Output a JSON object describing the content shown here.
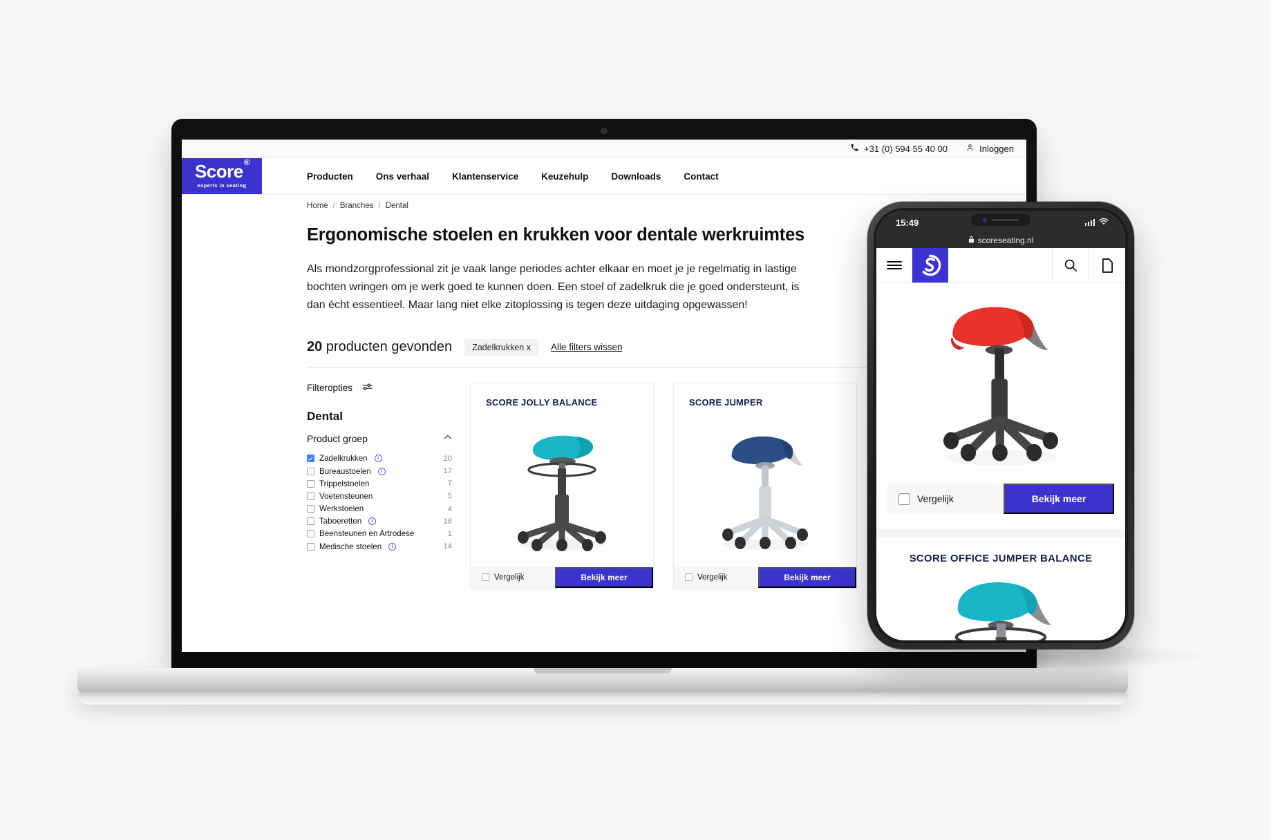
{
  "desktop": {
    "topbar": {
      "phone_icon": "phone-icon",
      "phone": "+31 (0) 594 55 40 00",
      "account_icon": "user-icon",
      "login": "Inloggen"
    },
    "logo": {
      "word": "Score",
      "sup": "®",
      "tagline": "experts in seating"
    },
    "nav": [
      {
        "label": "Producten"
      },
      {
        "label": "Ons verhaal"
      },
      {
        "label": "Klantenservice"
      },
      {
        "label": "Keuzehulp"
      },
      {
        "label": "Downloads"
      },
      {
        "label": "Contact"
      }
    ],
    "breadcrumbs": [
      "Home",
      "Branches",
      "Dental"
    ],
    "page_title": "Ergonomische stoelen en krukken voor dentale werkruimtes",
    "intro": "Als mondzorgprofessional zit je vaak lange periodes achter elkaar en moet je je regelmatig in lastige bochten wringen om je werk goed te kunnen doen. Een stoel of zadelkruk die je goed ondersteunt, is dan écht essentieel. Maar lang niet elke zitoplossing is tegen deze uitdaging opgewassen!",
    "results": {
      "count": "20",
      "count_suffix": " producten gevonden",
      "active_filter": "Zadelkrukken x",
      "clear_all": "Alle filters wissen"
    },
    "filters": {
      "heading": "Filteropties",
      "icon": "sliders-icon",
      "branch_title": "Dental",
      "group_label": "Product groep",
      "collapse_icon": "chevron-up-icon",
      "options": [
        {
          "label": "Zadelkrukken",
          "count": "20",
          "checked": true,
          "info": true
        },
        {
          "label": "Bureaustoelen",
          "count": "17",
          "checked": false,
          "info": true
        },
        {
          "label": "Trippelstoelen",
          "count": "7",
          "checked": false,
          "info": false
        },
        {
          "label": "Voetensteunen",
          "count": "5",
          "checked": false,
          "info": false
        },
        {
          "label": "Werkstoelen",
          "count": "4",
          "checked": false,
          "info": false
        },
        {
          "label": "Taboeretten",
          "count": "18",
          "checked": false,
          "info": true
        },
        {
          "label": "Beensteunen en Artrodese",
          "count": "1",
          "checked": false,
          "info": false
        },
        {
          "label": "Medische stoelen",
          "count": "14",
          "checked": false,
          "info": true
        }
      ]
    },
    "products": [
      {
        "title": "SCORE JOLLY BALANCE",
        "compare": "Vergelijk",
        "cta": "Bekijk meer",
        "seat_color": "#19b5c7",
        "base_color": "#4a4a4a"
      },
      {
        "title": "SCORE JUMPER",
        "compare": "Vergelijk",
        "cta": "Bekijk meer",
        "seat_color": "#2a4d86",
        "base_color": "#c8cbd0"
      }
    ]
  },
  "phone": {
    "status": {
      "time": "15:49",
      "signal_icon": "cellular-icon",
      "wifi_icon": "wifi-icon"
    },
    "url": {
      "lock_icon": "lock-icon",
      "text": "scoreseating.nl"
    },
    "nav": {
      "menu_icon": "hamburger-icon",
      "logo_letter": "S",
      "search_icon": "search-icon",
      "page_icon": "document-icon"
    },
    "products": [
      {
        "title": "",
        "compare": "Vergelijk",
        "cta": "Bekijk meer",
        "seat_color": "#e8332a"
      },
      {
        "title": "SCORE OFFICE JUMPER BALANCE",
        "seat_color": "#19b5c7"
      }
    ]
  },
  "colors": {
    "brand_blue": "#3b33cf",
    "title_navy": "#14204a",
    "accent_checkbox": "#3b7ff0",
    "info_purple": "#5b57d6"
  }
}
